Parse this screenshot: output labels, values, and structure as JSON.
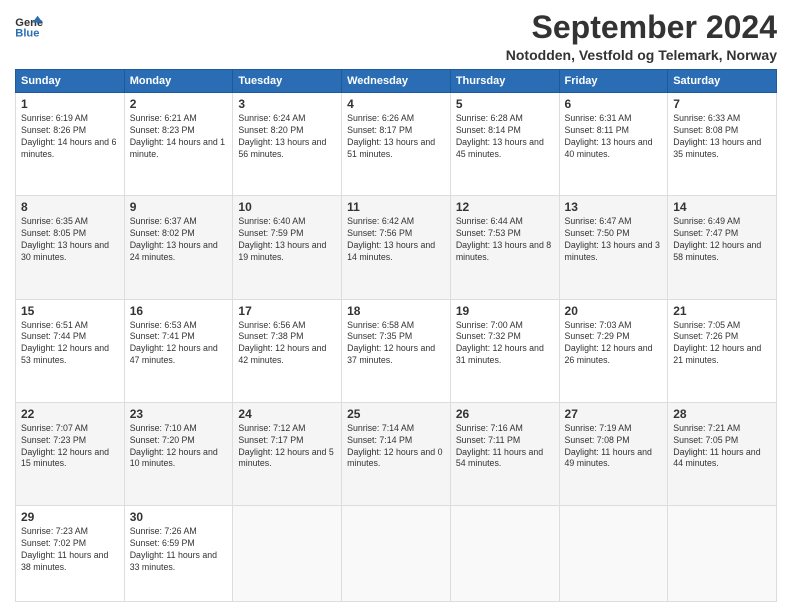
{
  "header": {
    "logo_line1": "General",
    "logo_line2": "Blue",
    "month": "September 2024",
    "location": "Notodden, Vestfold og Telemark, Norway"
  },
  "weekdays": [
    "Sunday",
    "Monday",
    "Tuesday",
    "Wednesday",
    "Thursday",
    "Friday",
    "Saturday"
  ],
  "weeks": [
    [
      {
        "day": 1,
        "sunrise": "6:19 AM",
        "sunset": "8:26 PM",
        "daylight": "14 hours and 6 minutes."
      },
      {
        "day": 2,
        "sunrise": "6:21 AM",
        "sunset": "8:23 PM",
        "daylight": "14 hours and 1 minute."
      },
      {
        "day": 3,
        "sunrise": "6:24 AM",
        "sunset": "8:20 PM",
        "daylight": "13 hours and 56 minutes."
      },
      {
        "day": 4,
        "sunrise": "6:26 AM",
        "sunset": "8:17 PM",
        "daylight": "13 hours and 51 minutes."
      },
      {
        "day": 5,
        "sunrise": "6:28 AM",
        "sunset": "8:14 PM",
        "daylight": "13 hours and 45 minutes."
      },
      {
        "day": 6,
        "sunrise": "6:31 AM",
        "sunset": "8:11 PM",
        "daylight": "13 hours and 40 minutes."
      },
      {
        "day": 7,
        "sunrise": "6:33 AM",
        "sunset": "8:08 PM",
        "daylight": "13 hours and 35 minutes."
      }
    ],
    [
      {
        "day": 8,
        "sunrise": "6:35 AM",
        "sunset": "8:05 PM",
        "daylight": "13 hours and 30 minutes."
      },
      {
        "day": 9,
        "sunrise": "6:37 AM",
        "sunset": "8:02 PM",
        "daylight": "13 hours and 24 minutes."
      },
      {
        "day": 10,
        "sunrise": "6:40 AM",
        "sunset": "7:59 PM",
        "daylight": "13 hours and 19 minutes."
      },
      {
        "day": 11,
        "sunrise": "6:42 AM",
        "sunset": "7:56 PM",
        "daylight": "13 hours and 14 minutes."
      },
      {
        "day": 12,
        "sunrise": "6:44 AM",
        "sunset": "7:53 PM",
        "daylight": "13 hours and 8 minutes."
      },
      {
        "day": 13,
        "sunrise": "6:47 AM",
        "sunset": "7:50 PM",
        "daylight": "13 hours and 3 minutes."
      },
      {
        "day": 14,
        "sunrise": "6:49 AM",
        "sunset": "7:47 PM",
        "daylight": "12 hours and 58 minutes."
      }
    ],
    [
      {
        "day": 15,
        "sunrise": "6:51 AM",
        "sunset": "7:44 PM",
        "daylight": "12 hours and 53 minutes."
      },
      {
        "day": 16,
        "sunrise": "6:53 AM",
        "sunset": "7:41 PM",
        "daylight": "12 hours and 47 minutes."
      },
      {
        "day": 17,
        "sunrise": "6:56 AM",
        "sunset": "7:38 PM",
        "daylight": "12 hours and 42 minutes."
      },
      {
        "day": 18,
        "sunrise": "6:58 AM",
        "sunset": "7:35 PM",
        "daylight": "12 hours and 37 minutes."
      },
      {
        "day": 19,
        "sunrise": "7:00 AM",
        "sunset": "7:32 PM",
        "daylight": "12 hours and 31 minutes."
      },
      {
        "day": 20,
        "sunrise": "7:03 AM",
        "sunset": "7:29 PM",
        "daylight": "12 hours and 26 minutes."
      },
      {
        "day": 21,
        "sunrise": "7:05 AM",
        "sunset": "7:26 PM",
        "daylight": "12 hours and 21 minutes."
      }
    ],
    [
      {
        "day": 22,
        "sunrise": "7:07 AM",
        "sunset": "7:23 PM",
        "daylight": "12 hours and 15 minutes."
      },
      {
        "day": 23,
        "sunrise": "7:10 AM",
        "sunset": "7:20 PM",
        "daylight": "12 hours and 10 minutes."
      },
      {
        "day": 24,
        "sunrise": "7:12 AM",
        "sunset": "7:17 PM",
        "daylight": "12 hours and 5 minutes."
      },
      {
        "day": 25,
        "sunrise": "7:14 AM",
        "sunset": "7:14 PM",
        "daylight": "12 hours and 0 minutes."
      },
      {
        "day": 26,
        "sunrise": "7:16 AM",
        "sunset": "7:11 PM",
        "daylight": "11 hours and 54 minutes."
      },
      {
        "day": 27,
        "sunrise": "7:19 AM",
        "sunset": "7:08 PM",
        "daylight": "11 hours and 49 minutes."
      },
      {
        "day": 28,
        "sunrise": "7:21 AM",
        "sunset": "7:05 PM",
        "daylight": "11 hours and 44 minutes."
      }
    ],
    [
      {
        "day": 29,
        "sunrise": "7:23 AM",
        "sunset": "7:02 PM",
        "daylight": "11 hours and 38 minutes."
      },
      {
        "day": 30,
        "sunrise": "7:26 AM",
        "sunset": "6:59 PM",
        "daylight": "11 hours and 33 minutes."
      },
      null,
      null,
      null,
      null,
      null
    ]
  ]
}
